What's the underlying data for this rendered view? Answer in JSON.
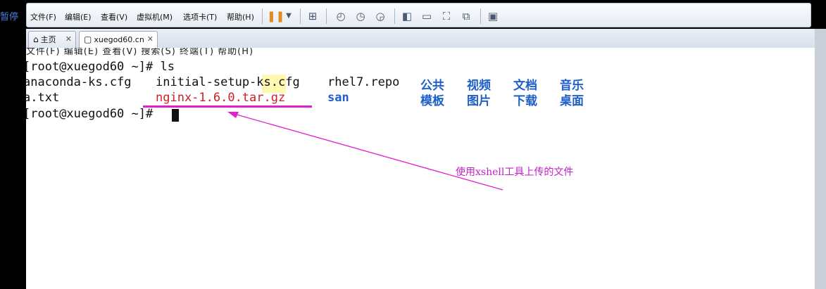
{
  "side": {
    "pause_label": "暂停"
  },
  "menu": {
    "items": [
      "文件(F)",
      "编辑(E)",
      "查看(V)",
      "虚拟机(M)",
      "选项卡(T)",
      "帮助(H)"
    ]
  },
  "toolbar_icons": [
    "pause-icon",
    "dropdown-icon",
    "network-icon",
    "snapshot-icon",
    "revert-snapshot-icon",
    "snapshot-manager-icon",
    "console-view-icon",
    "quick-switch-icon",
    "fullscreen-icon",
    "unity-icon",
    "thumbnail-icon"
  ],
  "tabs": [
    {
      "label": "主页",
      "icon": "home-icon",
      "active": false
    },
    {
      "label": "xuegod60.cn",
      "icon": "vm-icon",
      "active": true
    }
  ],
  "terminal": {
    "menu_text": "文件(F)  编辑(E)  查看(V)  搜索(S)  终端(T)  帮助(H)",
    "line1": "[root@xuegod60 ~]# ls",
    "files_row1": {
      "anaconda": "anaconda-ks.cfg",
      "initial": "initial-setup-ks.cfg",
      "rhel": "rhel7.repo",
      "d1": "公共",
      "d2": "视频",
      "d3": "文档",
      "d4": "音乐"
    },
    "files_row2": {
      "a": "a.txt",
      "nginx": "nginx-1.6.0.tar.gz",
      "san": "san",
      "d1": "模板",
      "d2": "图片",
      "d3": "下载",
      "d4": "桌面"
    },
    "line3": "[root@xuegod60 ~]# "
  },
  "annotation": {
    "text": "使用xshell工具上传的文件",
    "color": "#c21fc9"
  },
  "colors": {
    "dir_blue": "#1f5fc8",
    "archive_red": "#d11e26",
    "marker_magenta": "#e01fd0"
  }
}
